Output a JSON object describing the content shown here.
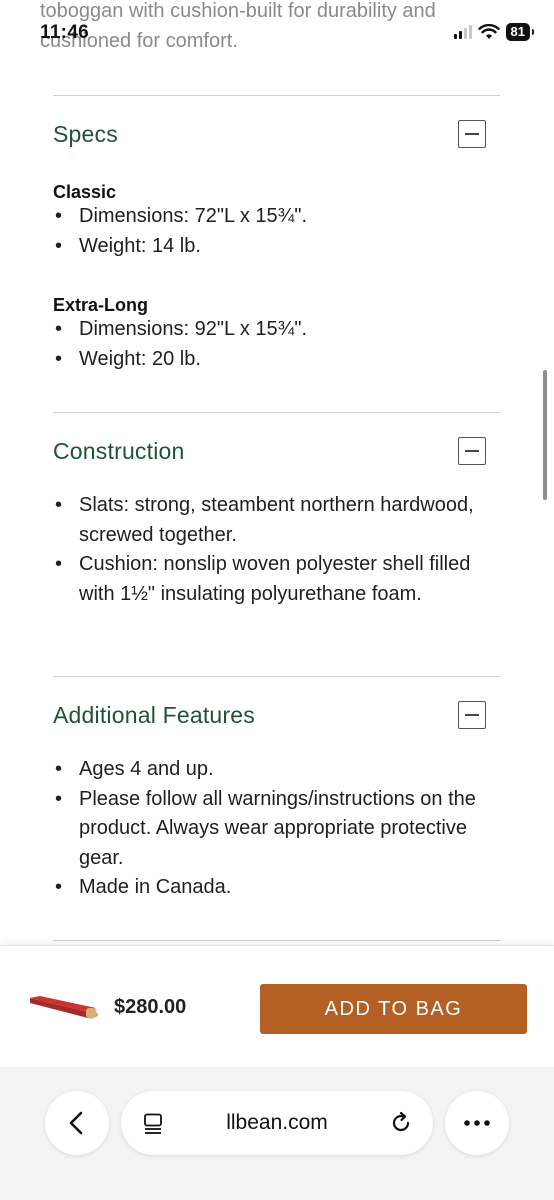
{
  "background_text": "toboggan with cushion-built for durability and cushioned for comfort.",
  "status": {
    "time": "11:46",
    "battery": "81"
  },
  "sections": [
    {
      "title": "Specs",
      "groups": [
        {
          "heading": "Classic",
          "items": [
            "Dimensions: 72\"L x 15¾\".",
            "Weight: 14 lb."
          ]
        },
        {
          "heading": "Extra-Long",
          "items": [
            "Dimensions: 92\"L x 15¾\".",
            "Weight: 20 lb."
          ]
        }
      ]
    },
    {
      "title": "Construction",
      "items": [
        "Slats: strong, steambent northern hardwood, screwed together.",
        "Cushion: nonslip woven polyester shell filled with 1½\" insulating polyurethane foam."
      ]
    },
    {
      "title": "Additional Features",
      "items": [
        "Ages 4 and up.",
        "Please follow all warnings/instructions on the product. Always wear appropriate protective gear.",
        "Made in Canada."
      ]
    }
  ],
  "buy_bar": {
    "price": "$280.00",
    "add_button": "ADD TO BAG"
  },
  "browser": {
    "url": "llbean.com"
  },
  "colors": {
    "heading_green": "#1f5336",
    "button_orange": "#b45f24"
  },
  "icons": [
    "back-arrow-icon",
    "tabs-icon",
    "reload-icon",
    "more-icon",
    "collapse-icon"
  ]
}
